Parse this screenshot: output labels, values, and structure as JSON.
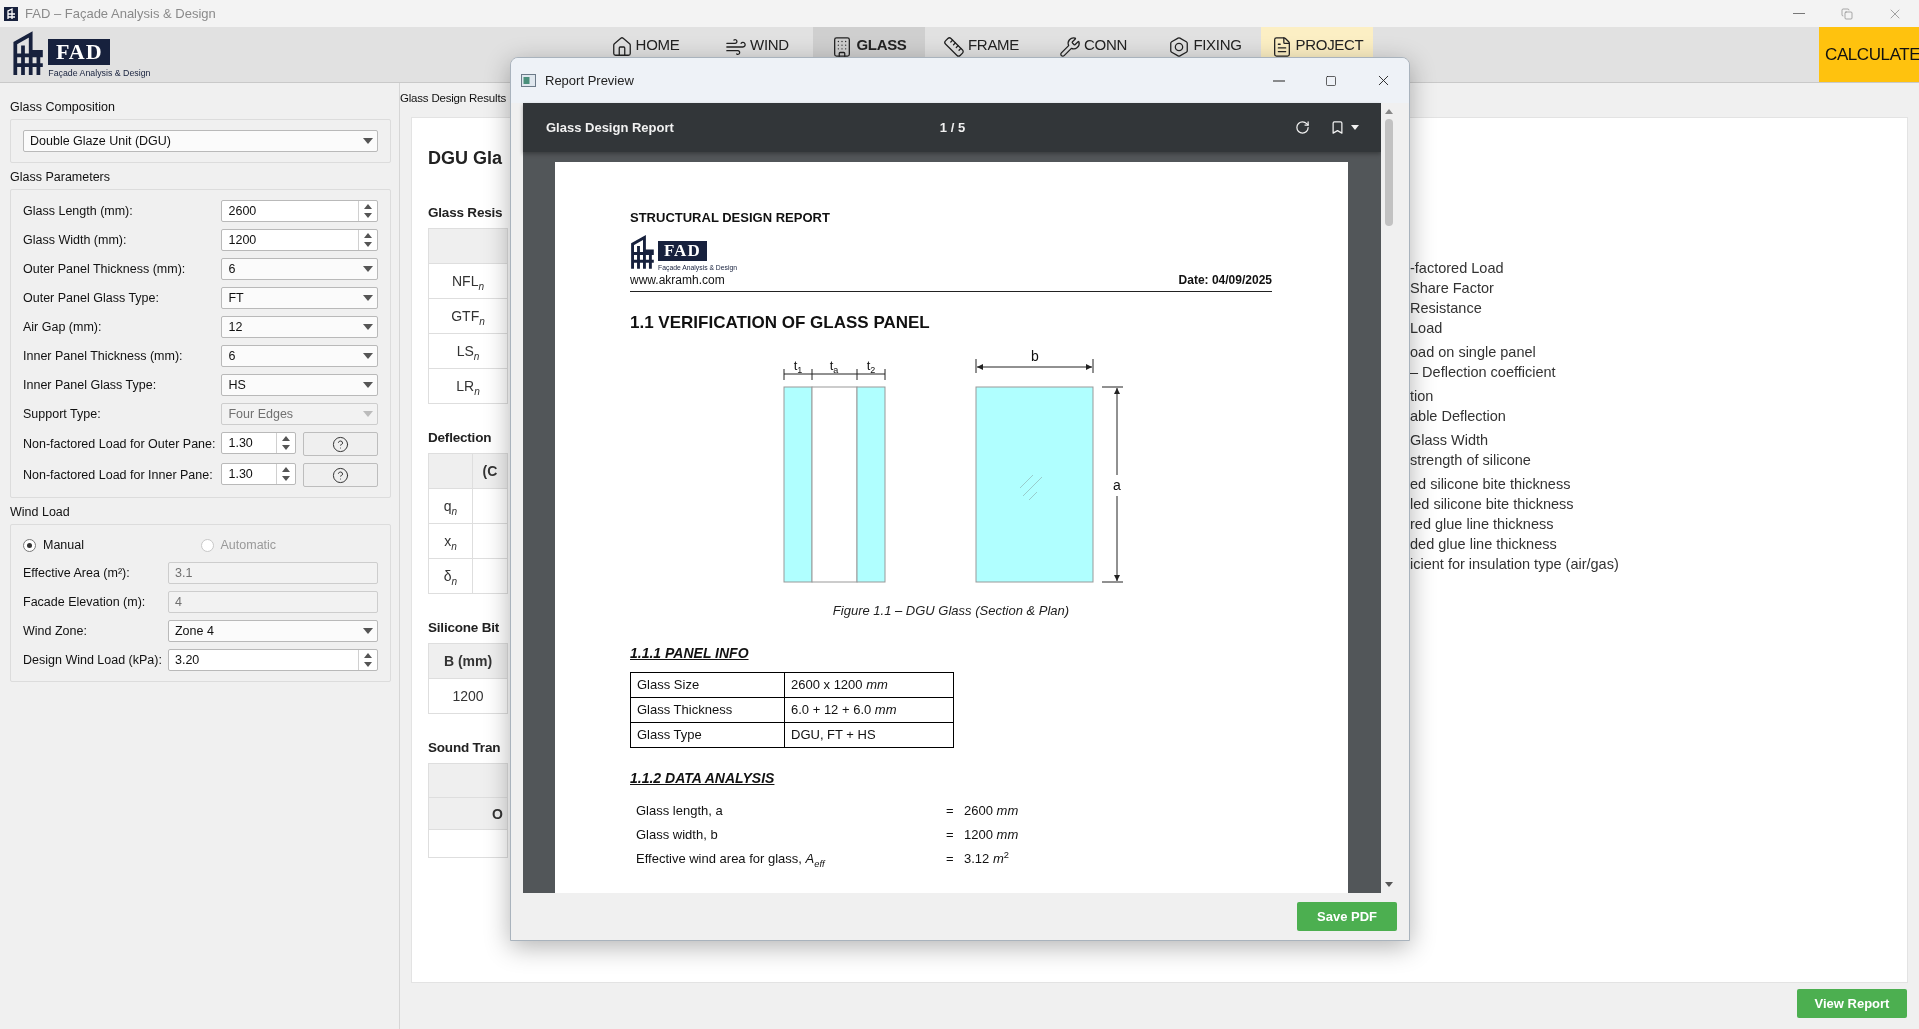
{
  "window": {
    "title": "FAD – Façade Analysis & Design"
  },
  "toolbar": {
    "logo": {
      "mark": "FAD",
      "tagline": "Façade Analysis & Design"
    },
    "tabs": [
      {
        "label": "HOME",
        "selected": false,
        "highlighted": false
      },
      {
        "label": "WIND",
        "selected": false,
        "highlighted": false
      },
      {
        "label": "GLASS",
        "selected": true,
        "highlighted": false
      },
      {
        "label": "FRAME",
        "selected": false,
        "highlighted": false
      },
      {
        "label": "CONN",
        "selected": false,
        "highlighted": false
      },
      {
        "label": "FIXING",
        "selected": false,
        "highlighted": false
      },
      {
        "label": "PROJECT",
        "selected": false,
        "highlighted": true
      }
    ],
    "action": "CALCULATE"
  },
  "sidebar": {
    "groups": [
      {
        "title": "Glass Composition",
        "fields": [
          {
            "kind": "combo",
            "value": "Double Glaze Unit (DGU)",
            "disabled": false
          }
        ]
      },
      {
        "title": "Glass Parameters",
        "fields": [
          {
            "label": "Glass Length (mm):",
            "kind": "spin",
            "value": "2600",
            "disabled": false
          },
          {
            "label": "Glass Width (mm):",
            "kind": "spin",
            "value": "1200",
            "disabled": false
          },
          {
            "label": "Outer Panel Thickness (mm):",
            "kind": "combo",
            "value": "6",
            "disabled": false
          },
          {
            "label": "Outer Panel Glass Type:",
            "kind": "combo",
            "value": "FT",
            "disabled": false
          },
          {
            "label": "Air Gap (mm):",
            "kind": "combo",
            "value": "12",
            "disabled": false
          },
          {
            "label": "Inner Panel Thickness (mm):",
            "kind": "combo",
            "value": "6",
            "disabled": false
          },
          {
            "label": "Inner Panel Glass Type:",
            "kind": "combo",
            "value": "HS",
            "disabled": false
          },
          {
            "label": "Support Type:",
            "kind": "combo",
            "value": "Four Edges",
            "disabled": true
          },
          {
            "label": "Non-factored Load for Outer Pane:",
            "kind": "spin_help",
            "value": "1.30",
            "disabled": false
          },
          {
            "label": "Non-factored Load for Inner Pane:",
            "kind": "spin_help",
            "value": "1.30",
            "disabled": false
          }
        ]
      },
      {
        "title": "Wind Load",
        "fields": [
          {
            "kind": "radio",
            "options": [
              {
                "label": "Manual",
                "selected": true,
                "disabled": false
              },
              {
                "label": "Automatic",
                "selected": false,
                "disabled": true
              }
            ]
          },
          {
            "label": "Effective Area (m²):",
            "kind": "text",
            "value": "3.1",
            "disabled": true
          },
          {
            "label": "Facade Elevation (m):",
            "kind": "text",
            "value": "4",
            "disabled": true
          },
          {
            "label": "Wind Zone:",
            "kind": "combo",
            "value": "Zone 4",
            "disabled": false
          },
          {
            "label": "Design Wind Load (kPa):",
            "kind": "spin",
            "value": "3.20",
            "disabled": false
          }
        ]
      }
    ]
  },
  "results": {
    "label": "Glass Design Results",
    "heading": "DGU Gla",
    "sections": [
      {
        "title": "Glass Resis",
        "kind": "label_rows",
        "cells": [
          "NFL$_{n}$",
          "GTF$_{n}$",
          "LS$_{n}$",
          "LR$_{n}$"
        ]
      },
      {
        "title": "Deflection",
        "kind": "matrix",
        "header": "(C",
        "cells": [
          "q$_{n}$",
          "x$_{n}$",
          "δ$_{n}$"
        ]
      },
      {
        "title": "Silicone Bit",
        "kind": "value_table",
        "header": "B (mm)",
        "cells": [
          "1200"
        ]
      },
      {
        "title": "Sound Tran",
        "kind": "double_header",
        "header": "O"
      }
    ],
    "notes": [
      [
        "-factored Load",
        "Share Factor",
        "Resistance",
        "Load"
      ],
      [
        "oad on single panel",
        "– Deflection coefficient"
      ],
      [
        "tion",
        "able Deflection"
      ],
      [
        "Glass Width",
        "strength of silicone"
      ],
      [
        "ed silicone bite thickness",
        "led silicone bite thickness",
        "red glue line thickness",
        "ded glue line thickness",
        "icient for insulation type (air/gas)"
      ]
    ],
    "view_button": "View Report"
  },
  "report_window": {
    "title": "Report Preview",
    "viewer_title": "Glass Design Report",
    "page_indicator": "1 / 5",
    "page": {
      "header": "STRUCTURAL DESIGN REPORT",
      "logo": {
        "mark": "FAD",
        "tagline": "Façade Analysis & Design"
      },
      "website": "www.akramh.com",
      "date": "Date: 04/09/2025",
      "section_title": "1.1 VERIFICATION OF GLASS PANEL",
      "figure": {
        "section_labels": [
          {
            "text": "t",
            "sub": "1"
          },
          {
            "text": "t",
            "sub": "a"
          },
          {
            "text": "t",
            "sub": "2"
          }
        ],
        "width_label": "b",
        "height_label": "a",
        "caption": "Figure 1.1 – DGU Glass (Section & Plan)"
      },
      "panel_info": {
        "title": "1.1.1 PANEL INFO",
        "rows": [
          [
            "Glass Size",
            "2600 x 1200 *mm*"
          ],
          [
            "Glass Thickness",
            "6.0 + 12 + 6.0 *mm*"
          ],
          [
            "Glass Type",
            "DGU, FT + HS"
          ]
        ]
      },
      "data_analysis": {
        "title": "1.1.2 DATA ANALYSIS",
        "rows": [
          {
            "label": "Glass length, a",
            "sign": "=",
            "value": "2600 *mm*"
          },
          {
            "label": "Glass width, b",
            "sign": "=",
            "value": "1200 *mm*"
          },
          {
            "label": "Effective wind area for glass, *A*$_{eff}$",
            "sign": "=",
            "value": "3.12 *m*$^{2}$"
          }
        ]
      }
    },
    "save_button": "Save PDF"
  }
}
